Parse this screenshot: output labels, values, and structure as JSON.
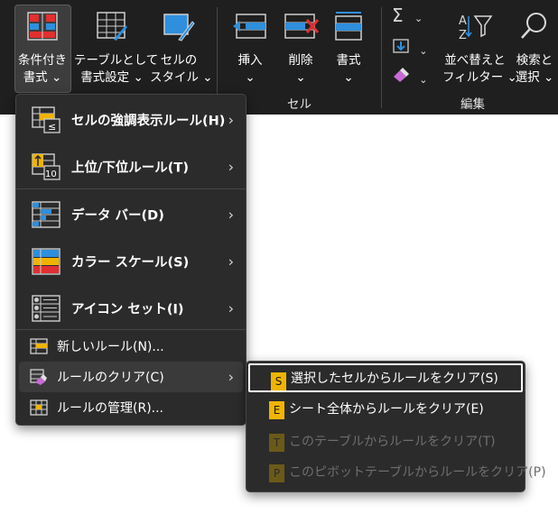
{
  "ribbon": {
    "buttons": {
      "conditional_formatting": {
        "line1": "条件付き",
        "line2": "書式 ⌄",
        "icon": "conditional-formatting-icon"
      },
      "format_as_table": {
        "line1": "テーブルとして",
        "line2": "書式設定 ⌄",
        "icon": "table-format-icon"
      },
      "cell_styles": {
        "line1": "セルの",
        "line2": "スタイル ⌄",
        "icon": "cell-styles-icon"
      },
      "insert": {
        "line1": "挿入",
        "line2": "⌄",
        "icon": "insert-cells-icon"
      },
      "delete": {
        "line1": "削除",
        "line2": "⌄",
        "icon": "delete-cells-icon"
      },
      "format": {
        "line1": "書式",
        "line2": "⌄",
        "icon": "format-cells-icon"
      },
      "autosum": {
        "symbol": "Σ",
        "chevron": "⌄",
        "icon": "sigma-icon"
      },
      "fill": {
        "chevron": "⌄",
        "icon": "fill-down-icon"
      },
      "clear": {
        "chevron": "⌄",
        "icon": "eraser-icon"
      },
      "sort_filter": {
        "line1": "並べ替えと",
        "line2": "フィルター ⌄",
        "icon": "sort-filter-icon"
      },
      "find_select": {
        "line1": "検索と",
        "line2": "選択 ⌄",
        "icon": "search-icon"
      }
    },
    "groups": {
      "cells": "セル",
      "editing": "編集"
    }
  },
  "menu": {
    "items": [
      {
        "label": "セルの強調表示ルール(H)",
        "icon": "highlight-rules-icon",
        "submenu": true
      },
      {
        "label": "上位/下位ルール(T)",
        "icon": "top-bottom-rules-icon",
        "submenu": true
      },
      {
        "label": "データ バー(D)",
        "icon": "data-bars-icon",
        "submenu": true
      },
      {
        "label": "カラー スケール(S)",
        "icon": "color-scales-icon",
        "submenu": true
      },
      {
        "label": "アイコン セット(I)",
        "icon": "icon-sets-icon",
        "submenu": true
      },
      {
        "label": "新しいルール(N)...",
        "icon": "new-rule-icon",
        "submenu": false
      },
      {
        "label": "ルールのクリア(C)",
        "icon": "clear-rules-icon",
        "submenu": true
      },
      {
        "label": "ルールの管理(R)...",
        "icon": "manage-rules-icon",
        "submenu": false
      }
    ],
    "arrow": "›"
  },
  "submenu": {
    "items": [
      {
        "label": "選択したセルからルールをクリア(S)",
        "key": "S",
        "enabled": true,
        "selected": true
      },
      {
        "label": "シート全体からルールをクリア(E)",
        "key": "E",
        "enabled": true,
        "selected": false
      },
      {
        "label": "このテーブルからルールをクリア(T)",
        "key": "T",
        "enabled": false,
        "selected": false
      },
      {
        "label": "このピボットテーブルからルールをクリア(P)",
        "key": "P",
        "enabled": false,
        "selected": false
      }
    ]
  },
  "colors": {
    "ribbon_bg": "#1f1f1f",
    "menu_bg": "#2b2b2b",
    "keytip": "#f0b400",
    "accent_blue": "#2f8fdc",
    "accent_red": "#e03030",
    "accent_yellow": "#f0b400"
  }
}
